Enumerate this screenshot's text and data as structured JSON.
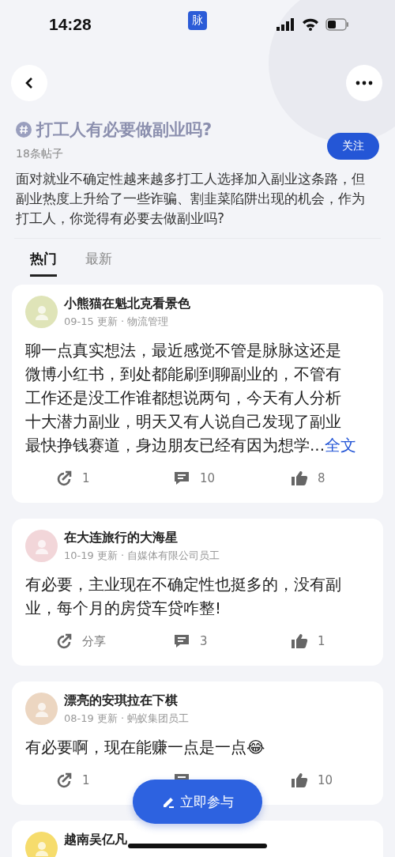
{
  "status_bar": {
    "time": "14:28",
    "app_badge": "脉"
  },
  "topic": {
    "title": "打工人有必要做副业吗?",
    "post_count": "18条帖子",
    "follow_button": "关注",
    "description": "面对就业不确定性越来越多打工人选择加入副业这条路，但副业热度上升给了一些诈骗、割韭菜陷阱出现的机会，作为打工人，你觉得有必要去做副业吗?"
  },
  "tabs": [
    {
      "label": "热门",
      "selected": true
    },
    {
      "label": "最新",
      "selected": false
    }
  ],
  "posts": [
    {
      "author": "小熊猫在魁北克看景色",
      "meta": "09-15 更新 · 物流管理",
      "color": "#dfe4b8",
      "body": "聊一点真实想法，最近感觉不管是脉脉这还是微博小红书，到处都能刷到聊副业的，不管有工作还是没工作谁都想说两句，今天有人分析十大潜力副业，明天又有人说自己发现了副业最快挣钱赛道，身边朋友已经有因为想学...",
      "more": "全文",
      "actions": [
        {
          "kind": "share",
          "label": "1"
        },
        {
          "kind": "comment",
          "label": "10"
        },
        {
          "kind": "like",
          "label": "8"
        }
      ]
    },
    {
      "author": "在大连旅行的大海星",
      "meta": "10-19 更新 · 自媒体有限公司员工",
      "color": "#f2d6d9",
      "body": "有必要，主业现在不确定性也挺多的，没有副业，每个月的房贷车贷咋整!",
      "actions": [
        {
          "kind": "share",
          "label": "分享"
        },
        {
          "kind": "comment",
          "label": "3"
        },
        {
          "kind": "like",
          "label": "1"
        }
      ]
    },
    {
      "author": "漂亮的安琪拉在下棋",
      "meta": "08-19 更新 · 蚂蚁集团员工",
      "color": "#ecd6c1",
      "body": "有必要啊，现在能赚一点是一点😂",
      "actions": [
        {
          "kind": "share",
          "label": "1"
        },
        {
          "kind": "comment"
        },
        {
          "kind": "like",
          "label": "10"
        }
      ]
    },
    {
      "author": "越南吴亿凡",
      "color": "#f6dc6c"
    }
  ],
  "join_button": "立即参与"
}
